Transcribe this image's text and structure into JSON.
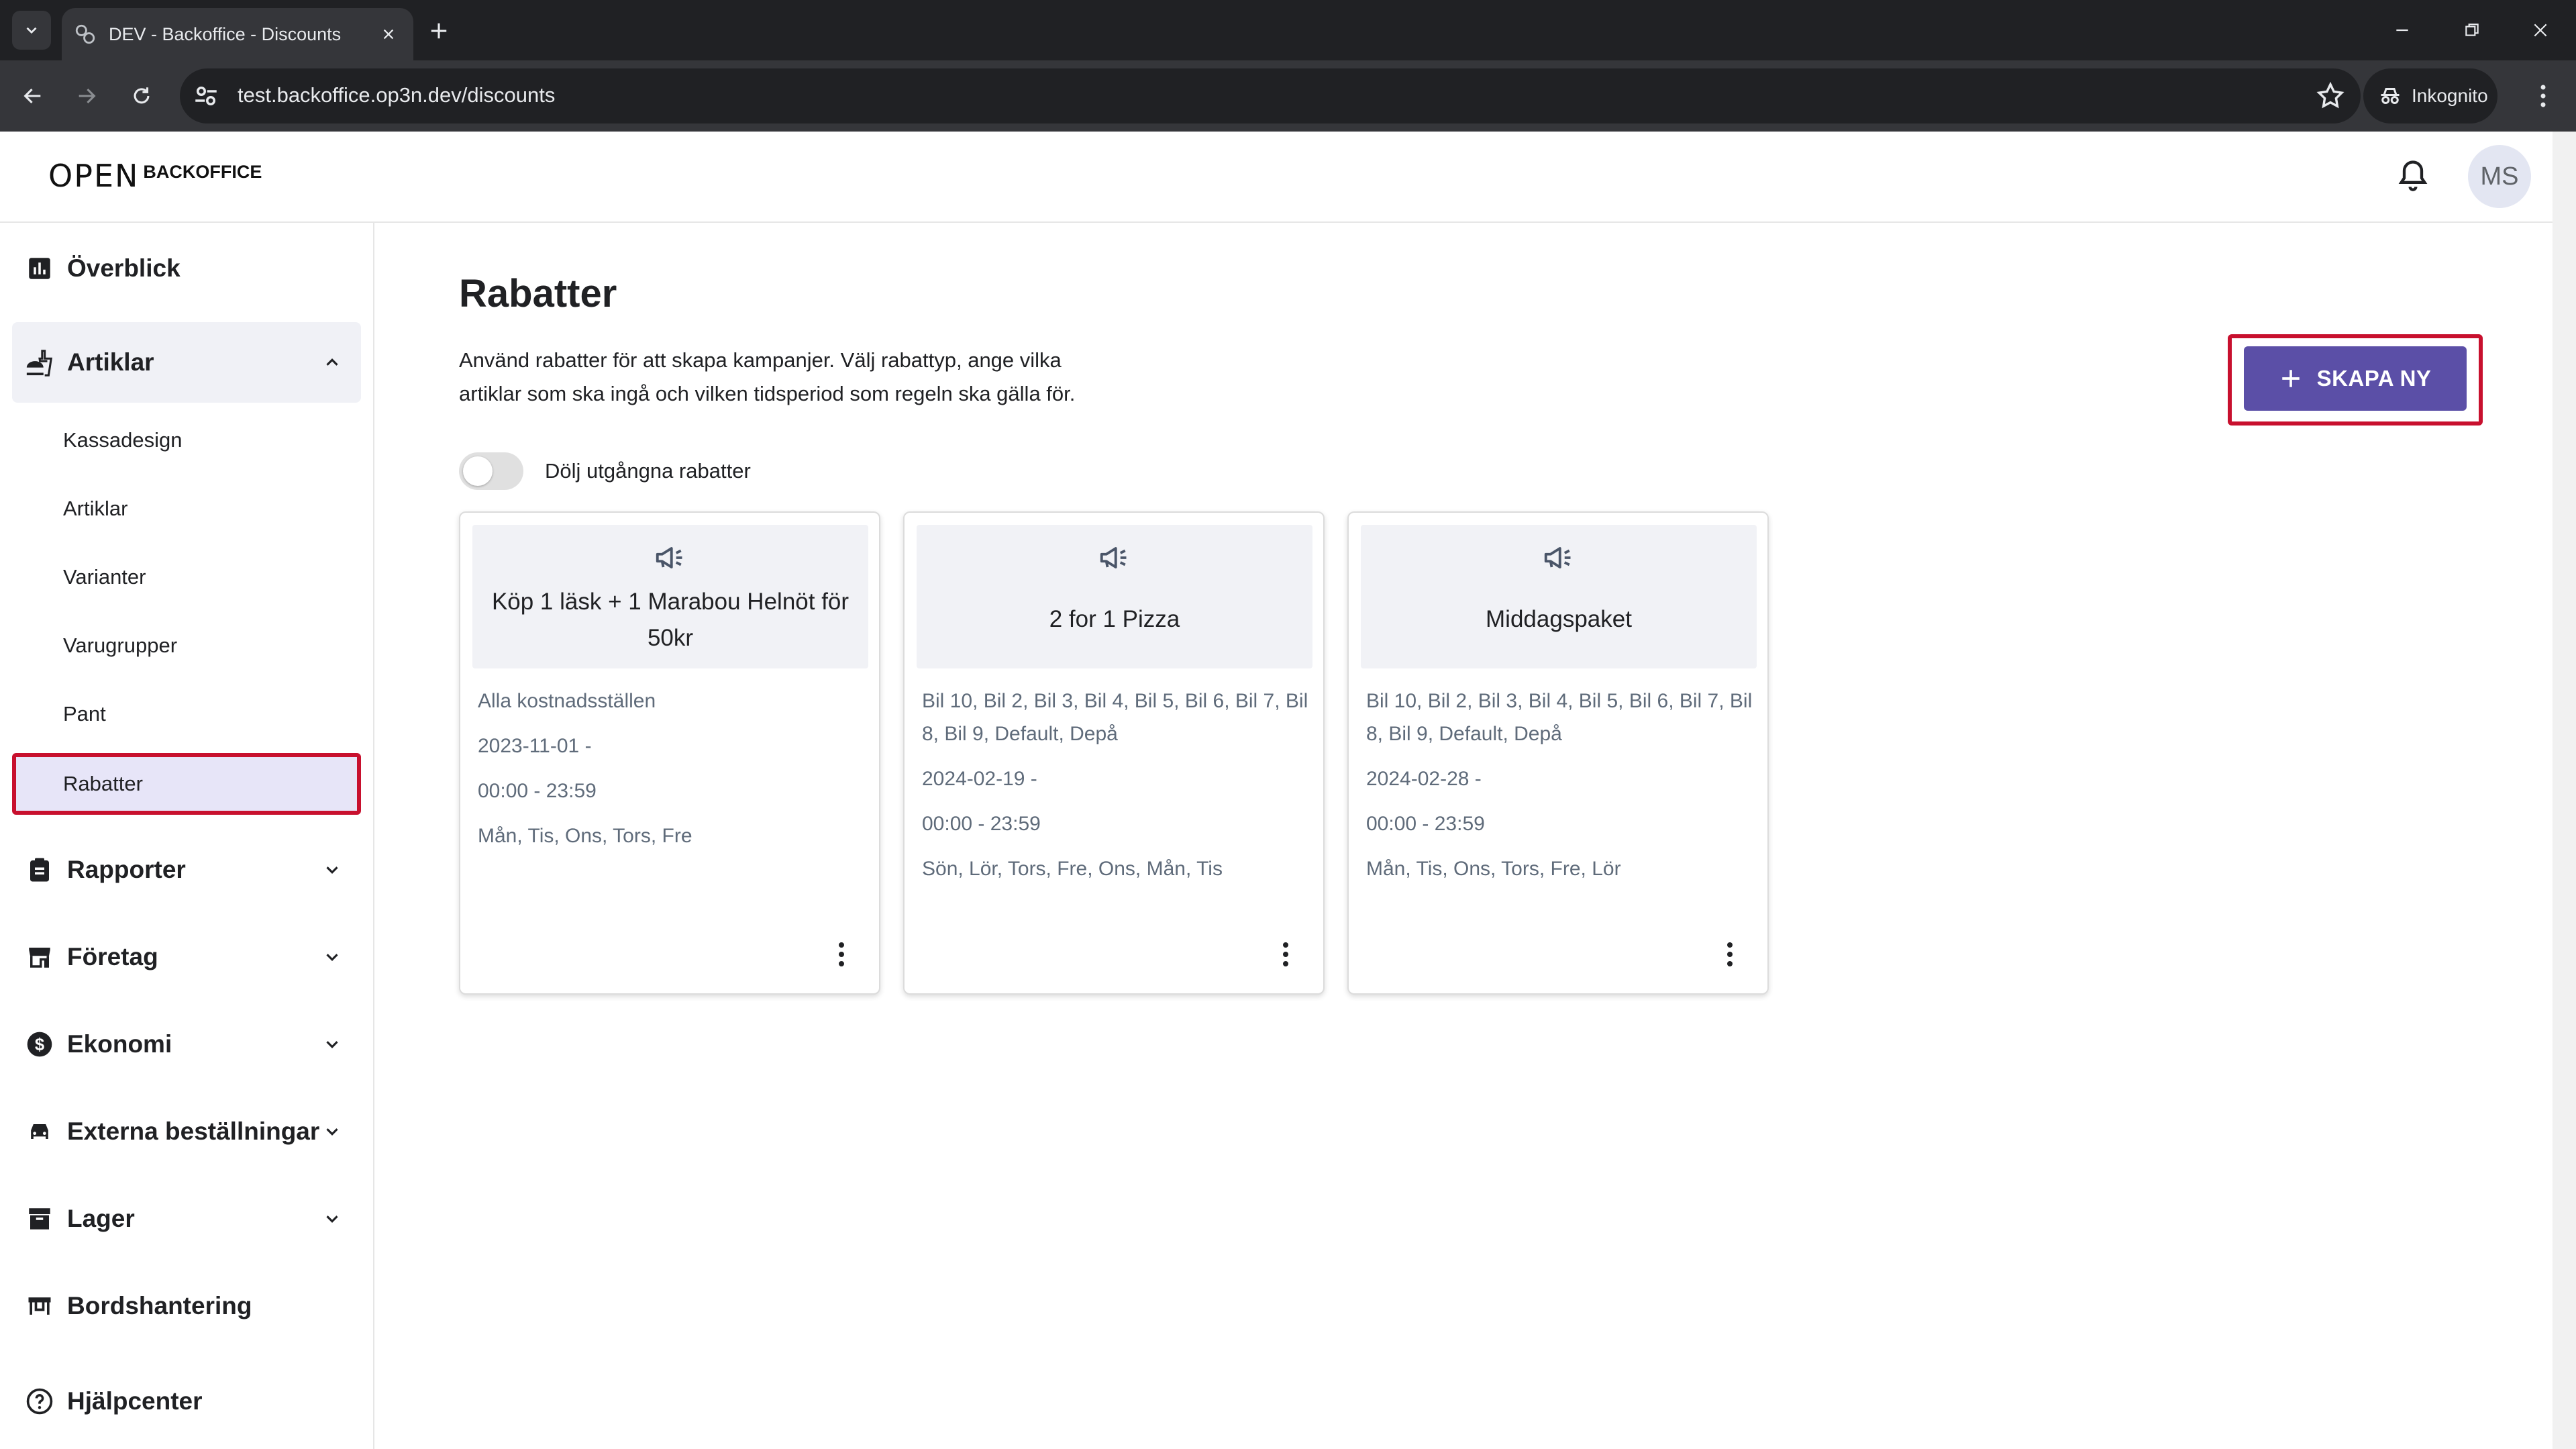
{
  "browser": {
    "tab_title": "DEV - Backoffice - Discounts",
    "url": "test.backoffice.op3n.dev/discounts",
    "incognito_label": "Inkognito"
  },
  "header": {
    "logo_mark": "OPEN",
    "logo_text": "BACKOFFICE",
    "avatar_initials": "MS"
  },
  "sidebar": {
    "items": [
      {
        "label": "Överblick",
        "icon": "chart-icon"
      },
      {
        "label": "Artiklar",
        "icon": "food-icon",
        "expanded": true
      },
      {
        "label": "Rapporter",
        "icon": "clipboard-icon"
      },
      {
        "label": "Företag",
        "icon": "store-icon"
      },
      {
        "label": "Ekonomi",
        "icon": "dollar-icon"
      },
      {
        "label": "Externa beställningar",
        "icon": "car-icon"
      },
      {
        "label": "Lager",
        "icon": "archive-icon"
      },
      {
        "label": "Bordshantering",
        "icon": "table-icon"
      },
      {
        "label": "Hjälpcenter",
        "icon": "help-icon"
      }
    ],
    "subitems": [
      "Kassadesign",
      "Artiklar",
      "Varianter",
      "Varugrupper",
      "Pant",
      "Rabatter"
    ],
    "active_subitem": "Rabatter"
  },
  "page": {
    "title": "Rabatter",
    "description": "Använd rabatter för att skapa kampanjer. Välj rabattyp, ange vilka artiklar som ska ingå och vilken tidsperiod som regeln ska gälla för.",
    "create_button": "SKAPA NY",
    "toggle_label": "Dölj utgångna rabatter",
    "toggle_on": false
  },
  "discounts": [
    {
      "name": "Köp 1 läsk + 1 Marabou Helnöt för 50kr",
      "locations": "Alla kostnadsställen",
      "date": "2023-11-01 -",
      "time": "00:00 - 23:59",
      "days": "Mån, Tis, Ons, Tors, Fre"
    },
    {
      "name": "2 for 1 Pizza",
      "locations": "Bil 10, Bil 2, Bil 3, Bil 4, Bil 5, Bil 6, Bil 7, Bil 8, Bil 9, Default, Depå",
      "date": "2024-02-19 -",
      "time": "00:00 - 23:59",
      "days": "Sön, Lör, Tors, Fre, Ons, Mån, Tis"
    },
    {
      "name": "Middagspaket",
      "locations": "Bil 10, Bil 2, Bil 3, Bil 4, Bil 5, Bil 6, Bil 7, Bil 8, Bil 9, Default, Depå",
      "date": "2024-02-28 -",
      "time": "00:00 - 23:59",
      "days": "Mån, Tis, Ons, Tors, Fre, Lör"
    }
  ],
  "colors": {
    "accent": "#5b4fa7",
    "highlight": "#c8102e",
    "active_bg": "#e7e5f8"
  }
}
